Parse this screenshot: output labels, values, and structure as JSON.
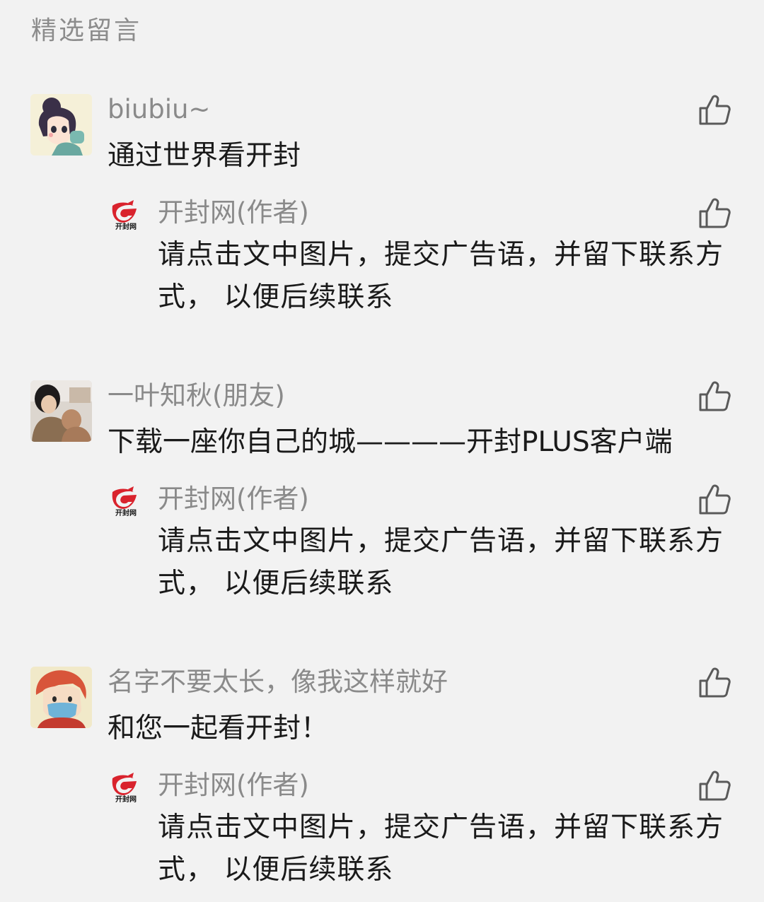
{
  "section_title": "精选留言",
  "comments": [
    {
      "nickname": "biubiu~",
      "content": "通过世界看开封",
      "avatar_icon": "cartoon-girl-avatar",
      "reply": {
        "author": "开封网(作者)",
        "logo_text": "开封网",
        "content": "请点击文中图片，提交广告语，并留下联系方式， 以便后续联系"
      }
    },
    {
      "nickname": "一叶知秋(朋友)",
      "content": "下载一座你自己的城————开封PLUS客户端",
      "avatar_icon": "photo-person-avatar",
      "reply": {
        "author": "开封网(作者)",
        "logo_text": "开封网",
        "content": "请点击文中图片，提交广告语，并留下联系方式， 以便后续联系"
      }
    },
    {
      "nickname": "名字不要太长，像我这样就好",
      "content": "和您一起看开封！",
      "avatar_icon": "cartoon-boy-mask-avatar",
      "reply": {
        "author": "开封网(作者)",
        "logo_text": "开封网",
        "content": "请点击文中图片，提交广告语，并留下联系方式， 以便后续联系"
      }
    }
  ],
  "colors": {
    "background": "#f2f2f2",
    "secondary_text": "#8a8a8a",
    "primary_text": "#1a1a1a",
    "logo_red": "#d9232d"
  },
  "icons": {
    "like": "thumbs-up-icon"
  }
}
